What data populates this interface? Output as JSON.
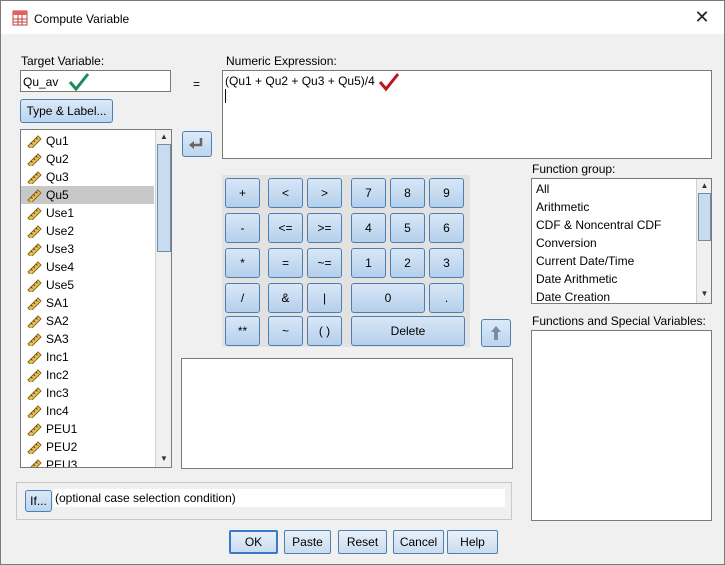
{
  "window": {
    "title": "Compute Variable",
    "close_symbol": "✕"
  },
  "target": {
    "label": "Target Variable:",
    "value": "Qu_av",
    "type_label_button": "Type & Label..."
  },
  "equals": "=",
  "numeric": {
    "label": "Numeric Expression:",
    "value": "(Qu1 + Qu2 + Qu3 + Qu5)/4"
  },
  "variables": [
    {
      "name": "Qu1"
    },
    {
      "name": "Qu2"
    },
    {
      "name": "Qu3"
    },
    {
      "name": "Qu5",
      "selected": true
    },
    {
      "name": "Use1"
    },
    {
      "name": "Use2"
    },
    {
      "name": "Use3"
    },
    {
      "name": "Use4"
    },
    {
      "name": "Use5"
    },
    {
      "name": "SA1"
    },
    {
      "name": "SA2"
    },
    {
      "name": "SA3"
    },
    {
      "name": "Inc1"
    },
    {
      "name": "Inc2"
    },
    {
      "name": "Inc3"
    },
    {
      "name": "Inc4"
    },
    {
      "name": "PEU1"
    },
    {
      "name": "PEU2"
    },
    {
      "name": "PEU3"
    }
  ],
  "keypad": {
    "ops": [
      "+",
      "<",
      ">",
      "-",
      "<=",
      ">=",
      "*",
      "=",
      "~=",
      "/",
      "&",
      "|",
      "**",
      "~",
      "( )"
    ],
    "digits": [
      "7",
      "8",
      "9",
      "4",
      "5",
      "6",
      "1",
      "2",
      "3"
    ],
    "zero": "0",
    "dot": ".",
    "delete": "Delete"
  },
  "function_group": {
    "label": "Function group:",
    "items": [
      "All",
      "Arithmetic",
      "CDF & Noncentral CDF",
      "Conversion",
      "Current Date/Time",
      "Date Arithmetic",
      "Date Creation"
    ]
  },
  "functions_label": "Functions and Special Variables:",
  "if_section": {
    "button": "If...",
    "text": "(optional case selection condition)"
  },
  "buttons": {
    "ok": "OK",
    "paste": "Paste",
    "reset": "Reset",
    "cancel": "Cancel",
    "help": "Help"
  },
  "colors": {
    "check_green": "#1e8a5a",
    "check_red": "#c0141c",
    "selection": "#c8c8c8",
    "button_border": "#4d7fb3"
  },
  "icons": {
    "app": "compute-variable-icon",
    "move_arrow": "arrow-left-icon",
    "up_arrow": "arrow-up-icon",
    "ruler": "scale-variable-icon"
  }
}
